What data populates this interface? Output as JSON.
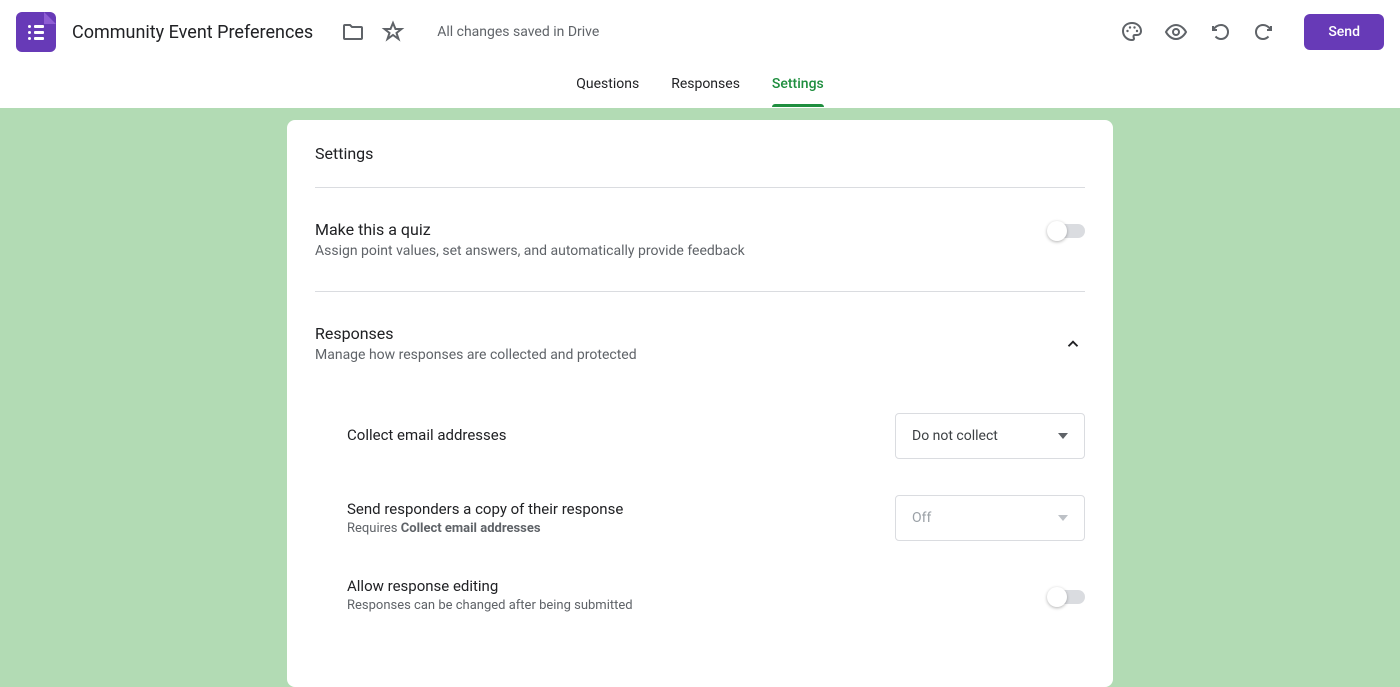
{
  "header": {
    "title": "Community Event Preferences",
    "save_status": "All changes saved in Drive",
    "send_label": "Send"
  },
  "tabs": {
    "questions": "Questions",
    "responses": "Responses",
    "settings": "Settings"
  },
  "settings": {
    "card_title": "Settings",
    "quiz": {
      "title": "Make this a quiz",
      "desc": "Assign point values, set answers, and automatically provide feedback"
    },
    "responses": {
      "title": "Responses",
      "desc": "Manage how responses are collected and protected",
      "collect_email": {
        "title": "Collect email addresses",
        "value": "Do not collect"
      },
      "send_copy": {
        "title": "Send responders a copy of their response",
        "requires_prefix": "Requires ",
        "requires_strong": "Collect email addresses",
        "value": "Off"
      },
      "allow_edit": {
        "title": "Allow response editing",
        "desc": "Responses can be changed after being submitted"
      }
    }
  }
}
